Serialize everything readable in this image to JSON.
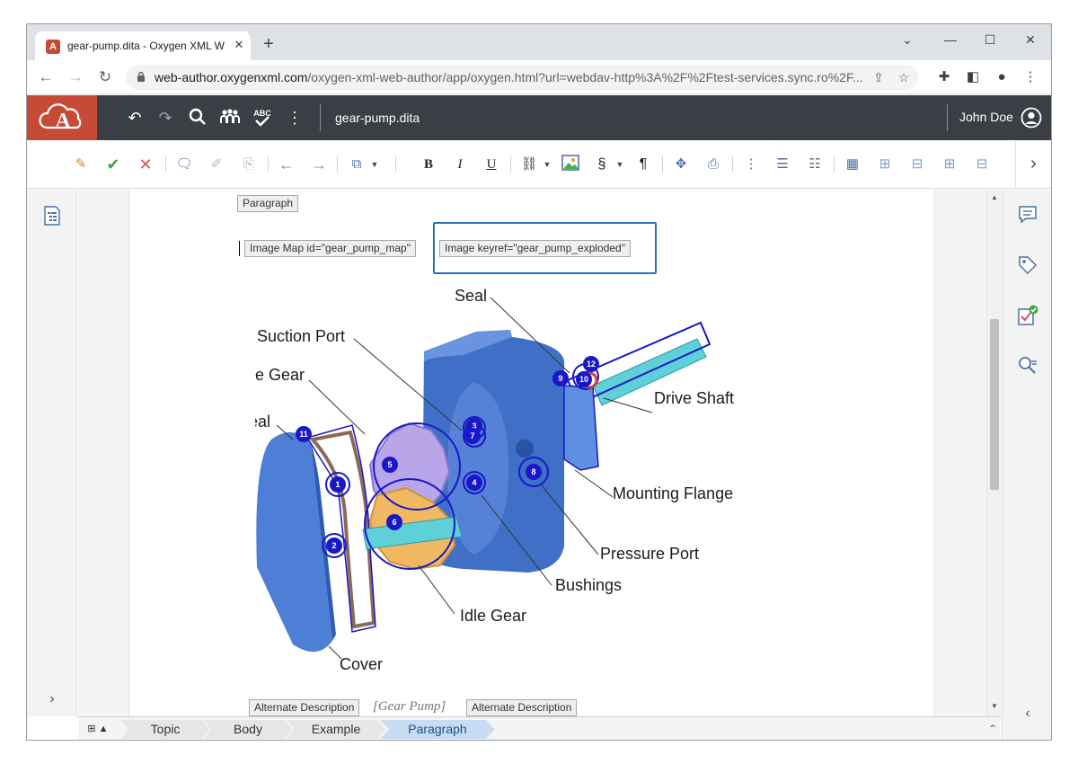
{
  "browser": {
    "tab_title": "gear-pump.dita - Oxygen XML W",
    "tab_close": "✕",
    "new_tab": "+",
    "url_host": "web-author.oxygenxml.com",
    "url_path": "/oxygen-xml-web-author/app/oxygen.html?url=webdav-http%3A%2F%2Ftest-services.sync.ro%2F...",
    "window_controls": [
      "⌄",
      "—",
      "☐",
      "✕"
    ]
  },
  "app": {
    "logo": "A",
    "document_name": "gear-pump.dita",
    "user_name": "John Doe"
  },
  "editor": {
    "tags": {
      "paragraph": "Paragraph",
      "image_map": "Image Map id=\"gear_pump_map\"",
      "image": "Image keyref=\"gear_pump_exploded\"",
      "alt_start": "Alternate Description",
      "alt_end": "Alternate Description"
    },
    "alt_text": "[Gear Pump]",
    "figure_labels": {
      "seal": "Seal",
      "suction_port": "Suction Port",
      "drive_gear": "Drive Gear",
      "case_seal": "Case Seal",
      "drive_shaft": "Drive Shaft",
      "mounting_flange": "Mounting Flange",
      "pressure_port": "Pressure Port",
      "bushings": "Bushings",
      "idle_gear": "Idle Gear",
      "cover": "Cover"
    },
    "hotspots": [
      "1",
      "2",
      "3",
      "4",
      "5",
      "6",
      "7",
      "8",
      "9",
      "10",
      "11",
      "12"
    ]
  },
  "breadcrumb": [
    "Topic",
    "Body",
    "Example",
    "Paragraph"
  ],
  "colors": {
    "header_bg": "#3b3f45",
    "logo_bg": "#c64a36",
    "selection_blue": "#2a6fc1",
    "hotspot_blue": "#1a17c9",
    "pump_body": "#4d7fd6",
    "drive_gear": "#b9a6e8",
    "idle_gear": "#f0b860",
    "shaft": "#5fd0d8"
  }
}
